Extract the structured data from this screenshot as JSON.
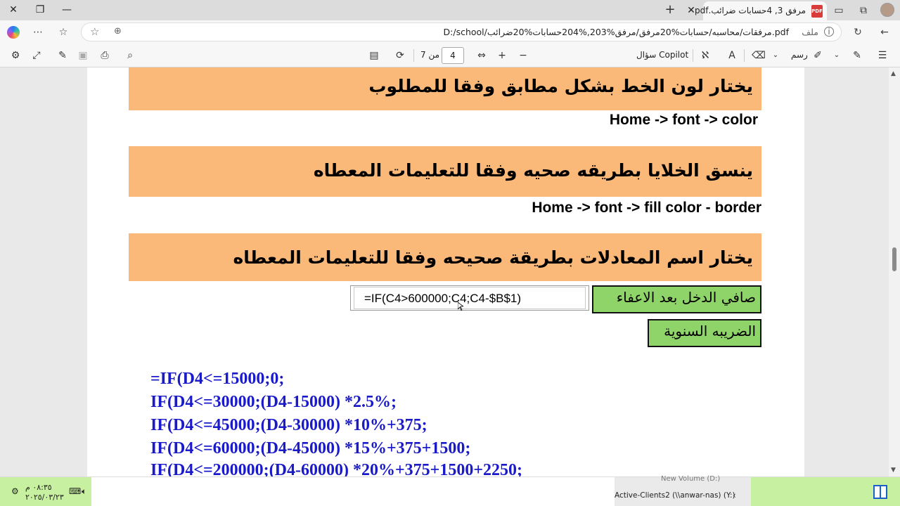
{
  "browser": {
    "tab_title": "مرفق 3, 4حسابات ضرائب.pdf",
    "tab_icon": "PDF",
    "url": "D:/school/مرفقات/محاسبه/حسابات%20مرفق/مرفق%203,%204حسابات%20ضرائب.pdf",
    "url_label": "ملف"
  },
  "pdf_toolbar": {
    "copilot_label": "سؤال Copilot",
    "draw_label": "رسم",
    "page_of": "من 7",
    "page_current": "4"
  },
  "document": {
    "band1": "يختار لون الخط بشكل مطابق وفقا للمطلوب",
    "path1": "Home -> font -> color",
    "band2": "ينسق الخلايا بطريقه صحيه وفقا للتعليمات المعطاه",
    "path2": "Home -> font -> fill color - border",
    "band3": "يختار اسم المعادلات بطريقة صحيحه وفقا للتعليمات المعطاه",
    "formula": "=IF(C4>600000;C4;C4-$B$1)",
    "green1": "صافي الدخل بعد الاعفاء",
    "green2": "الضريبه السنوية",
    "code": [
      "=IF(D4<=15000;0;",
      "IF(D4<=30000;(D4-15000) *2.5%;",
      "IF(D4<=45000;(D4-30000) *10%+375;",
      "IF(D4<=60000;(D4-45000) *15%+375+1500;",
      "IF(D4<=200000;(D4-60000) *20%+375+1500+2250;"
    ]
  },
  "taskbar": {
    "time": "٠٨:٣٥ م",
    "date": "٢٠٢٥/٠٣/٢٣",
    "drive_top": "New Volume (D:)",
    "drive_item": "Active-Clients2 (\\\\anwar-nas) (Y:)"
  },
  "colors": {
    "band": "#fbb979",
    "green_cell": "#8fd468",
    "code_text": "#1a1ac8"
  }
}
